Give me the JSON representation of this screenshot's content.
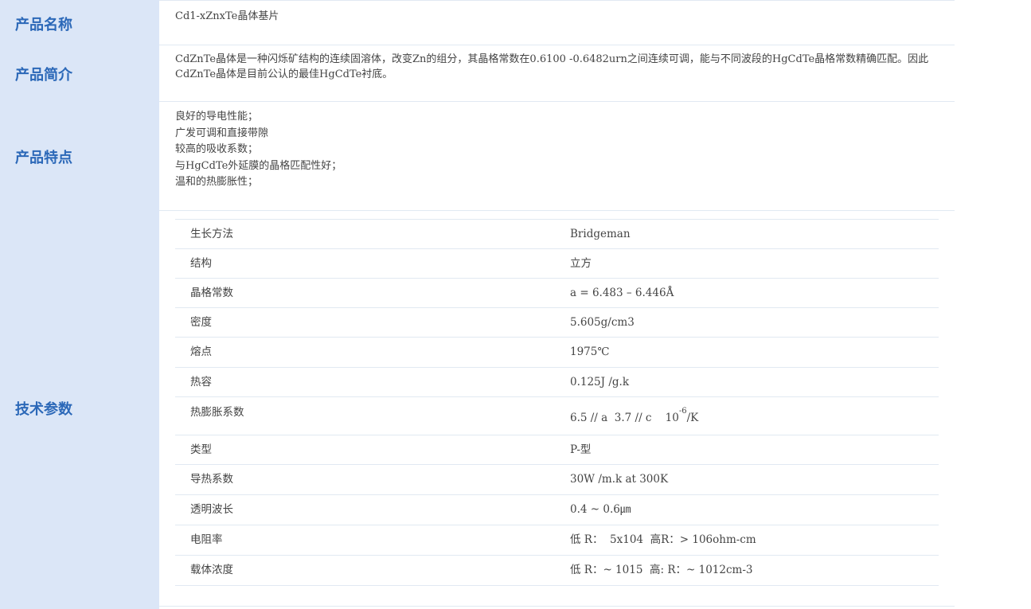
{
  "rows": {
    "name": {
      "label": "产品名称",
      "value": "Cd1-xZnxTe晶体基片"
    },
    "intro": {
      "label": "产品简介",
      "value": "CdZnTe晶体是一种闪烁矿结构的连续固溶体，改变Zn的组分，其晶格常数在0.6100 -0.6482urn之间连续可调，能与不同波段的HgCdTe晶格常数精确匹配。因此CdZnTe晶体是目前公认的最佳HgCdTe衬底。"
    },
    "features": {
      "label": "产品特点",
      "items": [
        "良好的导电性能；",
        "广发可调和直接带隙",
        "较高的吸收系数；",
        "与HgCdTe外延膜的晶格匹配性好；",
        "温和的热膨胀性；"
      ]
    },
    "specs": {
      "label": "技术参数",
      "items": [
        {
          "key": "生长方法",
          "value": "Bridgeman"
        },
        {
          "key": "结构",
          "value": "立方"
        },
        {
          "key": "晶格常数",
          "value": "a = 6.483 – 6.446Å"
        },
        {
          "key": "密度",
          "value": "5.605g/cm3"
        },
        {
          "key": "熔点",
          "value": "1975℃"
        },
        {
          "key": "热容",
          "value": "0.125J /g.k"
        },
        {
          "key": "热膨胀系数",
          "value_pre": "6.5 // a  3.7 // c    10",
          "value_sup": "-6",
          "value_post": "/K"
        },
        {
          "key": "类型",
          "value": "P-型"
        },
        {
          "key": "导热系数",
          "value": "30W /m.k at 300K"
        },
        {
          "key": "透明波长",
          "value": "0.4 ~ 0.6㎛"
        },
        {
          "key": "电阻率",
          "value": "低 R：  5x104  高R：> 106ohm-cm"
        },
        {
          "key": "载体浓度",
          "value": "低 R：~ 1015  高: R：~ 1012cm-3"
        }
      ]
    }
  },
  "colors": {
    "label_bg": "#dbe6f7",
    "label_text": "#2b68b8",
    "divider": "#e1e9f2"
  }
}
